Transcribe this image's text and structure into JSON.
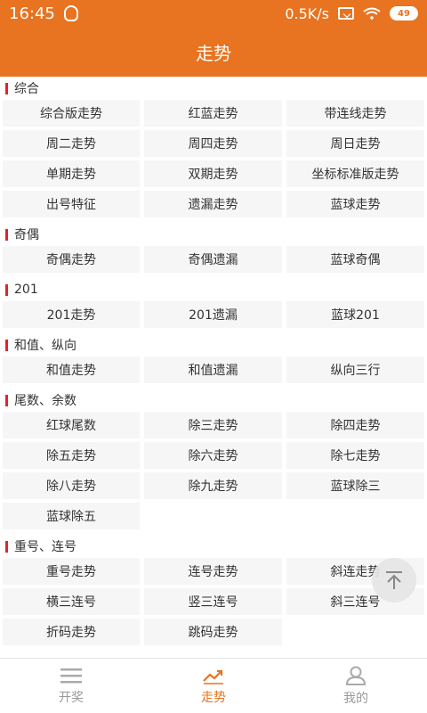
{
  "status": {
    "time": "16:45",
    "speed": "0.5K/s",
    "battery": "49"
  },
  "header": {
    "title": "走势"
  },
  "sections": [
    {
      "title": "综合",
      "items": [
        "综合版走势",
        "红蓝走势",
        "带连线走势",
        "周二走势",
        "周四走势",
        "周日走势",
        "单期走势",
        "双期走势",
        "坐标标准版走势",
        "出号特征",
        "遗漏走势",
        "蓝球走势"
      ]
    },
    {
      "title": "奇偶",
      "items": [
        "奇偶走势",
        "奇偶遗漏",
        "蓝球奇偶"
      ]
    },
    {
      "title": "201",
      "items": [
        "201走势",
        "201遗漏",
        "蓝球201"
      ]
    },
    {
      "title": "和值、纵向",
      "items": [
        "和值走势",
        "和值遗漏",
        "纵向三行"
      ]
    },
    {
      "title": "尾数、余数",
      "items": [
        "红球尾数",
        "除三走势",
        "除四走势",
        "除五走势",
        "除六走势",
        "除七走势",
        "除八走势",
        "除九走势",
        "蓝球除三",
        "蓝球除五"
      ]
    },
    {
      "title": "重号、连号",
      "items": [
        "重号走势",
        "连号走势",
        "斜连走势",
        "横三连号",
        "竖三连号",
        "斜三连号",
        "折码走势",
        "跳码走势"
      ]
    }
  ],
  "tabs": [
    {
      "label": "开奖",
      "icon": "menu-icon"
    },
    {
      "label": "走势",
      "icon": "trend-icon"
    },
    {
      "label": "我的",
      "icon": "user-icon"
    }
  ]
}
